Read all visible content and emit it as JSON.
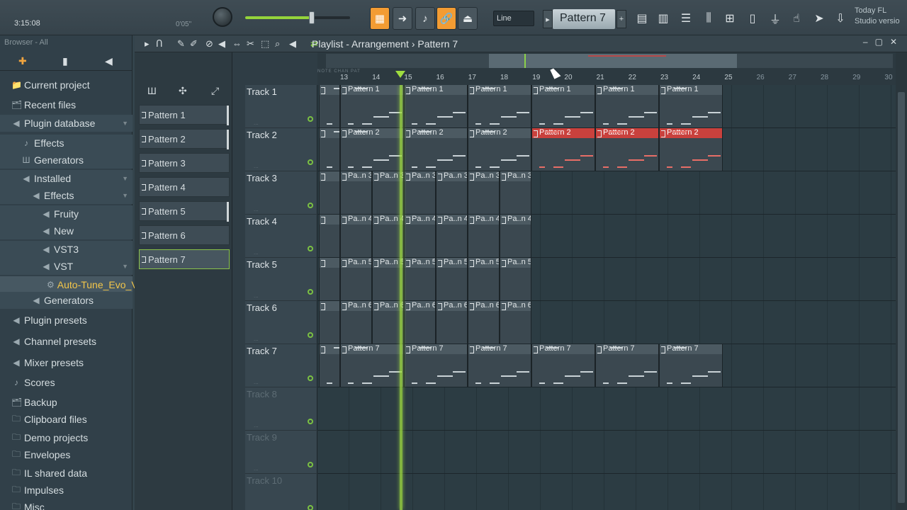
{
  "toolbar": {
    "song_time": "3:15:08",
    "time_sub": "0'05\"",
    "snap": "Line",
    "pattern": "Pattern 7",
    "today_line1": "Today  FL",
    "today_line2": "Studio versio",
    "accent": "#f39c33"
  },
  "browser": {
    "title": "Browser - All",
    "items": [
      {
        "label": "Current project",
        "icon": "📁"
      },
      {
        "label": "Recent files",
        "icon": "🗂"
      },
      {
        "label": "Plugin database",
        "icon": "◀"
      },
      {
        "label": "Effects",
        "icon": "♪"
      },
      {
        "label": "Generators",
        "icon": "Ш"
      },
      {
        "label": "Installed",
        "icon": "◀"
      },
      {
        "label": "Effects",
        "icon": "◀"
      },
      {
        "label": "Fruity",
        "icon": "◀"
      },
      {
        "label": "New",
        "icon": "◀"
      },
      {
        "label": "VST3",
        "icon": "◀"
      },
      {
        "label": "VST",
        "icon": "◀"
      },
      {
        "label": "Auto-Tune_Evo_VST",
        "icon": "⚙"
      },
      {
        "label": "Generators",
        "icon": "◀"
      },
      {
        "label": "Plugin presets",
        "icon": "◀"
      },
      {
        "label": "Channel presets",
        "icon": "◀"
      },
      {
        "label": "Mixer presets",
        "icon": "◀"
      },
      {
        "label": "Scores",
        "icon": "♪"
      },
      {
        "label": "Backup",
        "icon": "🗂"
      },
      {
        "label": "Clipboard files",
        "icon": "🗀"
      },
      {
        "label": "Demo projects",
        "icon": "🗀"
      },
      {
        "label": "Envelopes",
        "icon": "🗀"
      },
      {
        "label": "IL shared data",
        "icon": "🗀"
      },
      {
        "label": "Impulses",
        "icon": "🗀"
      },
      {
        "label": "Misc",
        "icon": "🗀"
      }
    ]
  },
  "playlist": {
    "title": "Playlist - Arrangement",
    "separator": "›",
    "current_pattern": "Pattern 7",
    "patterns": [
      "Pattern 1",
      "Pattern 2",
      "Pattern 3",
      "Pattern 4",
      "Pattern 5",
      "Pattern 6",
      "Pattern 7"
    ],
    "ruler_labels": [
      "NOTE",
      "CHAN",
      "PAT"
    ],
    "bars": [
      "13",
      "14",
      "15",
      "16",
      "17",
      "18",
      "19",
      "20",
      "21",
      "22",
      "23",
      "24",
      "25",
      "26",
      "27",
      "28",
      "29",
      "30"
    ],
    "tracks": [
      "Track 1",
      "Track 2",
      "Track 3",
      "Track 4",
      "Track 5",
      "Track 6",
      "Track 7",
      "Track 8",
      "Track 9",
      "Track 10"
    ],
    "clip_labels": {
      "t1": "Pattern 1",
      "t2": "Pattern 2",
      "t3": "Pa..n 3",
      "t4": "Pa..n 4",
      "t5": "Pa..n 5",
      "t6": "Pa..n 6",
      "t7": "Pattern 7"
    },
    "colors": {
      "selected_clip": "#c9413d",
      "playhead": "#9fdd3f"
    }
  }
}
